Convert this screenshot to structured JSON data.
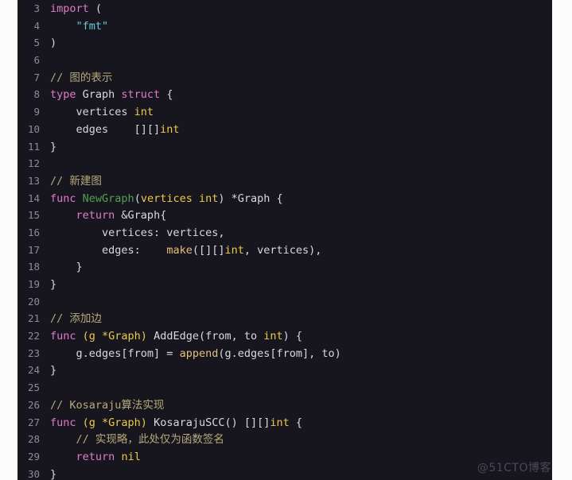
{
  "editor": {
    "language": "go",
    "theme": {
      "background": "#17161f",
      "page_background": "#fbfbfb",
      "line_number_color": "#8b8ba0",
      "plain_text": "#d8d8e0",
      "keyword": "#e07bc8",
      "function_declaration": "#51a14f",
      "builtin_function": "#e5c07b",
      "type": "#ecc94b",
      "string": "#69c7de",
      "comment": "#b5a97a"
    },
    "first_line_number": 3,
    "last_line_number": 30,
    "lines": [
      {
        "number": "3",
        "tokens": [
          {
            "text": "import",
            "kind": "keyword"
          },
          {
            "text": " (",
            "kind": "plain"
          }
        ]
      },
      {
        "number": "4",
        "tokens": [
          {
            "text": "    ",
            "kind": "plain"
          },
          {
            "text": "\"fmt\"",
            "kind": "string"
          }
        ]
      },
      {
        "number": "5",
        "tokens": [
          {
            "text": ")",
            "kind": "plain"
          }
        ]
      },
      {
        "number": "6",
        "tokens": []
      },
      {
        "number": "7",
        "tokens": [
          {
            "text": "// 图的表示",
            "kind": "comment"
          }
        ]
      },
      {
        "number": "8",
        "tokens": [
          {
            "text": "type",
            "kind": "keyword"
          },
          {
            "text": " Graph ",
            "kind": "plain"
          },
          {
            "text": "struct",
            "kind": "keyword"
          },
          {
            "text": " {",
            "kind": "plain"
          }
        ]
      },
      {
        "number": "9",
        "tokens": [
          {
            "text": "    vertices ",
            "kind": "plain"
          },
          {
            "text": "int",
            "kind": "type"
          }
        ]
      },
      {
        "number": "10",
        "tokens": [
          {
            "text": "    edges    [][]",
            "kind": "plain"
          },
          {
            "text": "int",
            "kind": "type"
          }
        ]
      },
      {
        "number": "11",
        "tokens": [
          {
            "text": "}",
            "kind": "plain"
          }
        ]
      },
      {
        "number": "12",
        "tokens": []
      },
      {
        "number": "13",
        "tokens": [
          {
            "text": "// 新建图",
            "kind": "comment"
          }
        ]
      },
      {
        "number": "14",
        "tokens": [
          {
            "text": "func",
            "kind": "keyword"
          },
          {
            "text": " ",
            "kind": "plain"
          },
          {
            "text": "NewGraph",
            "kind": "function_declaration"
          },
          {
            "text": "(",
            "kind": "plain"
          },
          {
            "text": "vertices int",
            "kind": "type"
          },
          {
            "text": ") *Graph {",
            "kind": "plain"
          }
        ]
      },
      {
        "number": "15",
        "tokens": [
          {
            "text": "    ",
            "kind": "plain"
          },
          {
            "text": "return",
            "kind": "keyword"
          },
          {
            "text": " &Graph{",
            "kind": "plain"
          }
        ]
      },
      {
        "number": "16",
        "tokens": [
          {
            "text": "        vertices: vertices,",
            "kind": "plain"
          }
        ]
      },
      {
        "number": "17",
        "tokens": [
          {
            "text": "        edges:    ",
            "kind": "plain"
          },
          {
            "text": "make",
            "kind": "builtin_function"
          },
          {
            "text": "([][]",
            "kind": "plain"
          },
          {
            "text": "int",
            "kind": "type"
          },
          {
            "text": ", vertices),",
            "kind": "plain"
          }
        ]
      },
      {
        "number": "18",
        "tokens": [
          {
            "text": "    }",
            "kind": "plain"
          }
        ]
      },
      {
        "number": "19",
        "tokens": [
          {
            "text": "}",
            "kind": "plain"
          }
        ]
      },
      {
        "number": "20",
        "tokens": []
      },
      {
        "number": "21",
        "tokens": [
          {
            "text": "// 添加边",
            "kind": "comment"
          }
        ]
      },
      {
        "number": "22",
        "tokens": [
          {
            "text": "func",
            "kind": "keyword"
          },
          {
            "text": " ",
            "kind": "plain"
          },
          {
            "text": "(g *Graph)",
            "kind": "type"
          },
          {
            "text": " AddEdge(from, to ",
            "kind": "plain"
          },
          {
            "text": "int",
            "kind": "type"
          },
          {
            "text": ") {",
            "kind": "plain"
          }
        ]
      },
      {
        "number": "23",
        "tokens": [
          {
            "text": "    g.edges[from] = ",
            "kind": "plain"
          },
          {
            "text": "append",
            "kind": "builtin_function"
          },
          {
            "text": "(g.edges[from], to)",
            "kind": "plain"
          }
        ]
      },
      {
        "number": "24",
        "tokens": [
          {
            "text": "}",
            "kind": "plain"
          }
        ]
      },
      {
        "number": "25",
        "tokens": []
      },
      {
        "number": "26",
        "tokens": [
          {
            "text": "// Kosaraju算法实现",
            "kind": "comment"
          }
        ]
      },
      {
        "number": "27",
        "tokens": [
          {
            "text": "func",
            "kind": "keyword"
          },
          {
            "text": " ",
            "kind": "plain"
          },
          {
            "text": "(g *Graph)",
            "kind": "type"
          },
          {
            "text": " KosarajuSCC() [][]",
            "kind": "plain"
          },
          {
            "text": "int",
            "kind": "type"
          },
          {
            "text": " {",
            "kind": "plain"
          }
        ]
      },
      {
        "number": "28",
        "tokens": [
          {
            "text": "    // 实现略，此处仅为函数签名",
            "kind": "comment"
          }
        ]
      },
      {
        "number": "29",
        "tokens": [
          {
            "text": "    ",
            "kind": "plain"
          },
          {
            "text": "return",
            "kind": "keyword"
          },
          {
            "text": " ",
            "kind": "plain"
          },
          {
            "text": "nil",
            "kind": "type"
          }
        ]
      },
      {
        "number": "30",
        "tokens": [
          {
            "text": "}",
            "kind": "plain"
          }
        ]
      }
    ]
  },
  "watermark": {
    "text": "@51CTO博客"
  }
}
